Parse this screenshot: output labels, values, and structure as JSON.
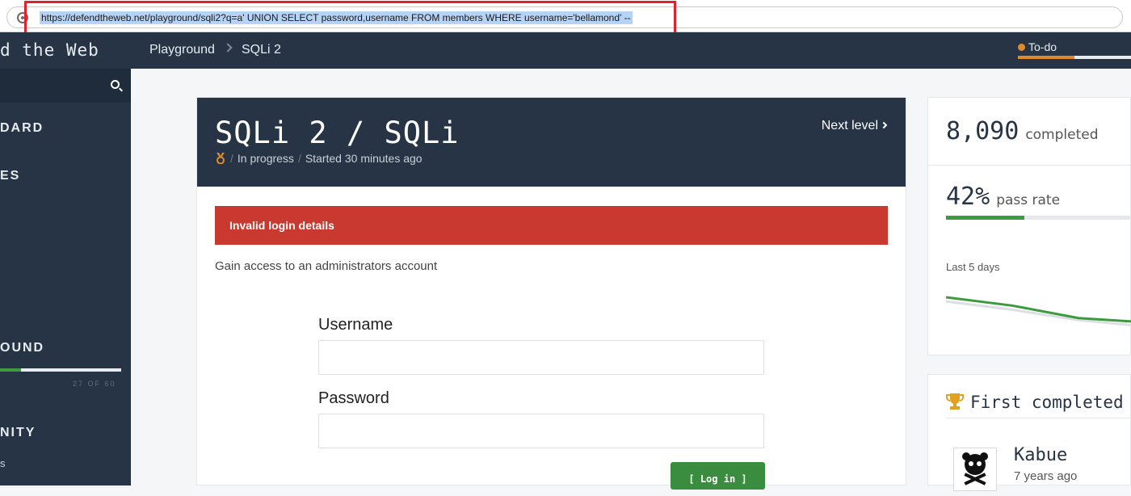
{
  "browser": {
    "url": "https://defendtheweb.net/playground/sqli2?q=a' UNION SELECT password,username FROM members WHERE username='bellamond' --"
  },
  "sidebar": {
    "brand": "d the Web",
    "headings": [
      "DARD",
      "ES",
      "OUND",
      "NITY"
    ],
    "progress_label": "27 OF 60",
    "progress_fraction": 0.17,
    "bottom_link": "s"
  },
  "topnav": {
    "breadcrumb": [
      "Playground",
      "SQLi 2"
    ],
    "todo_label": "To-do",
    "todo_fraction": 0.5
  },
  "challenge": {
    "title": "SQLi 2 / SQLi",
    "status": "In progress",
    "started": "Started 30 minutes ago",
    "next_level": "Next level",
    "alert": "Invalid login details",
    "description": "Gain access to an administrators account",
    "username_label": "Username",
    "password_label": "Password",
    "username_value": "",
    "password_value": "",
    "login_button": "[ Log in ]"
  },
  "stats": {
    "completed_count": "8,090",
    "completed_label": "completed",
    "pass_rate_value": "42%",
    "pass_rate_label": "pass rate",
    "pass_rate_fraction": 0.42,
    "sparkline_label": "Last 5 days",
    "sparkline_series": [
      {
        "values": [
          8,
          6,
          3,
          2,
          3
        ],
        "color": "#3c9a3f"
      },
      {
        "values": [
          7,
          5,
          2.5,
          1,
          2.5
        ],
        "color": "#dcdfe3"
      }
    ]
  },
  "first_completed": {
    "title": "First completed",
    "name": "Kabue",
    "time": "7 years ago"
  },
  "colors": {
    "navy": "#263445",
    "accent_green": "#3c9a3f",
    "alert_red": "#c9392f",
    "todo_orange": "#e08a2b",
    "highlight_red": "#e0202a"
  }
}
